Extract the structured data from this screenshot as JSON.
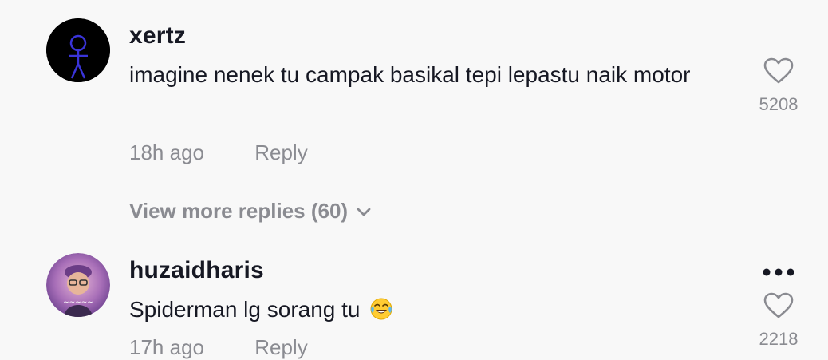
{
  "comments": [
    {
      "username": "xertz",
      "text": "imagine nenek tu campak basikal tepi lepastu naik motor",
      "time": "18h ago",
      "reply_label": "Reply",
      "likes": "5208",
      "view_more": "View more replies (60)"
    },
    {
      "username": "huzaidharis",
      "text": "Spiderman lg sorang tu",
      "emoji": "face-with-tears-of-joy-icon",
      "time": "17h ago",
      "reply_label": "Reply",
      "likes": "2218"
    }
  ],
  "colors": {
    "background": "#f8f8f8",
    "primary_text": "#161823",
    "secondary_text": "#8a8b91"
  }
}
